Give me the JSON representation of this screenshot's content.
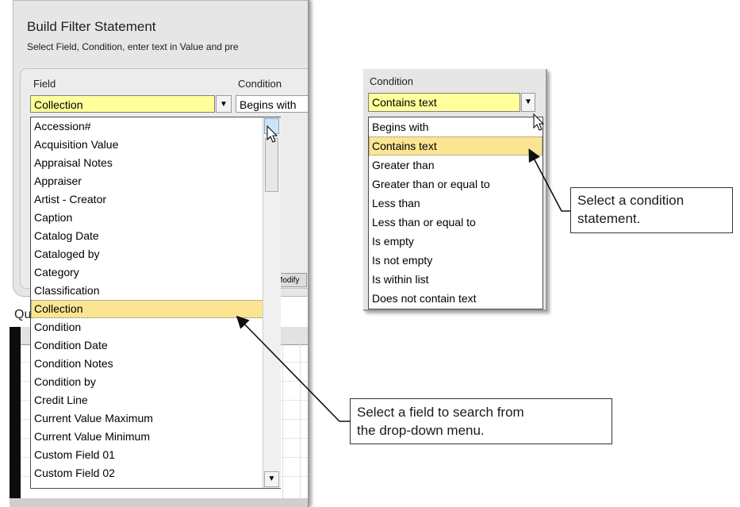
{
  "build_filter": {
    "title": "Build Filter Statement",
    "subtitle": "Select Field, Condition, enter text in Value and pre",
    "field_label": "Field",
    "condition_label": "Condition",
    "field_value": "Collection",
    "condition_value": "Begins with",
    "modify_fragment": "Modify",
    "query_fragment": "Qu"
  },
  "field_dropdown": {
    "selected": "Collection",
    "items": [
      "Accession#",
      "Acquisition Value",
      "Appraisal Notes",
      "Appraiser",
      "Artist - Creator",
      "Caption",
      "Catalog Date",
      "Cataloged by",
      "Category",
      "Classification",
      "Collection",
      "Condition",
      "Condition Date",
      "Condition Notes",
      "Condition by",
      "Credit Line",
      "Current Value Maximum",
      "Current Value Minimum",
      "Custom Field 01",
      "Custom Field 02"
    ]
  },
  "condition_panel": {
    "label": "Condition",
    "value": "Contains text",
    "selected": "Contains text",
    "items": [
      "Begins with",
      "Contains text",
      "Greater than",
      "Greater than or equal to",
      "Less than",
      "Less than or equal to",
      "Is empty",
      "Is not empty",
      "Is within list",
      "Does not contain text"
    ]
  },
  "callouts": {
    "condition": [
      "Select a condition",
      "statement."
    ],
    "field": [
      "Select a field to search from",
      "the drop-down menu."
    ]
  },
  "icons": {
    "dropdown_arrow": "▼",
    "cursor": "arrow-cursor"
  },
  "colors": {
    "highlight": "#fbe593",
    "combo_yellow": "#ffff9c"
  }
}
